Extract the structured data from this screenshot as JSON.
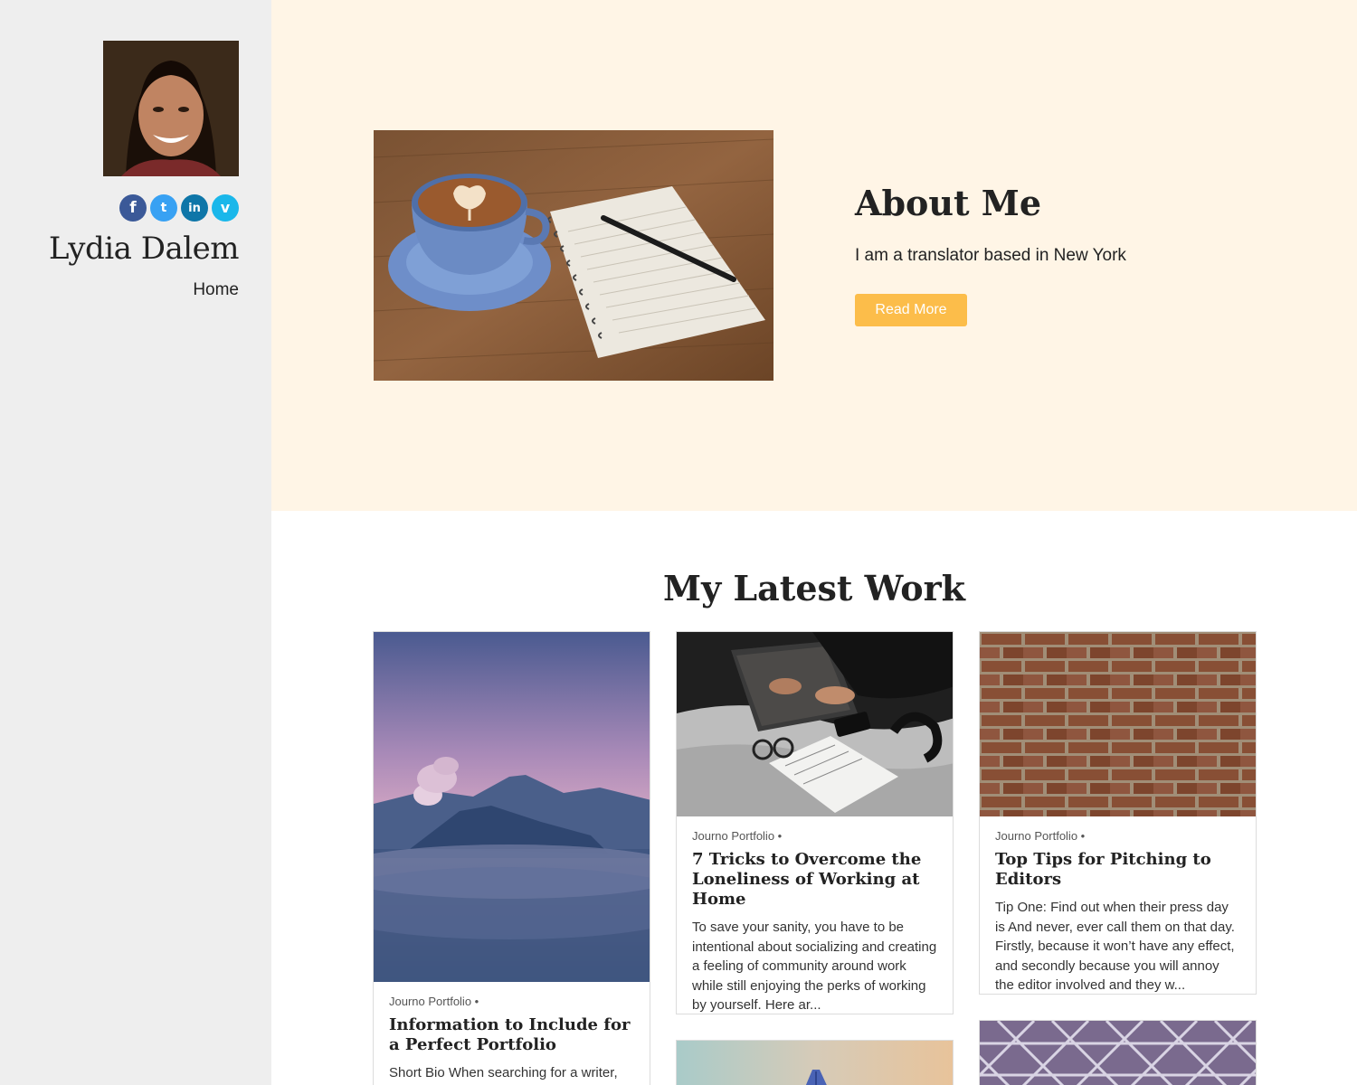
{
  "sidebar": {
    "site_name": "Lydia Dalem",
    "nav": [
      {
        "label": "Home"
      }
    ],
    "social_icons": [
      "facebook-icon",
      "twitter-icon",
      "linkedin-icon",
      "vimeo-icon"
    ],
    "social_glyphs": {
      "facebook": "f",
      "twitter": "t",
      "linkedin": "in",
      "vimeo": "v"
    }
  },
  "about": {
    "title": "About Me",
    "text": "I am a translator based in New York",
    "button_label": "Read More"
  },
  "work": {
    "title": "My Latest Work",
    "cards": [
      {
        "meta": "Journo Portfolio •",
        "title": "Information to Include for a Perfect Portfolio",
        "excerpt": "Short Bio When searching for a writer,"
      },
      {
        "meta": "Journo Portfolio •",
        "title": "7 Tricks to Overcome the Loneliness of Working at Home",
        "excerpt": "To save your sanity, you have to be intentional about socializing and creating a feeling of community around work while still enjoying the perks of working by yourself. Here ar..."
      },
      {
        "meta": "Journo Portfolio •",
        "title": "Top Tips for Pitching to Editors",
        "excerpt": "Tip One: Find out when their press day is And never, ever call them on that day. Firstly, because it won’t have any effect, and secondly because you will annoy the editor involved and they w..."
      }
    ]
  },
  "colors": {
    "sidebar_bg": "#eeeeee",
    "about_bg": "#fff5e6",
    "accent": "#fcbd4a"
  }
}
